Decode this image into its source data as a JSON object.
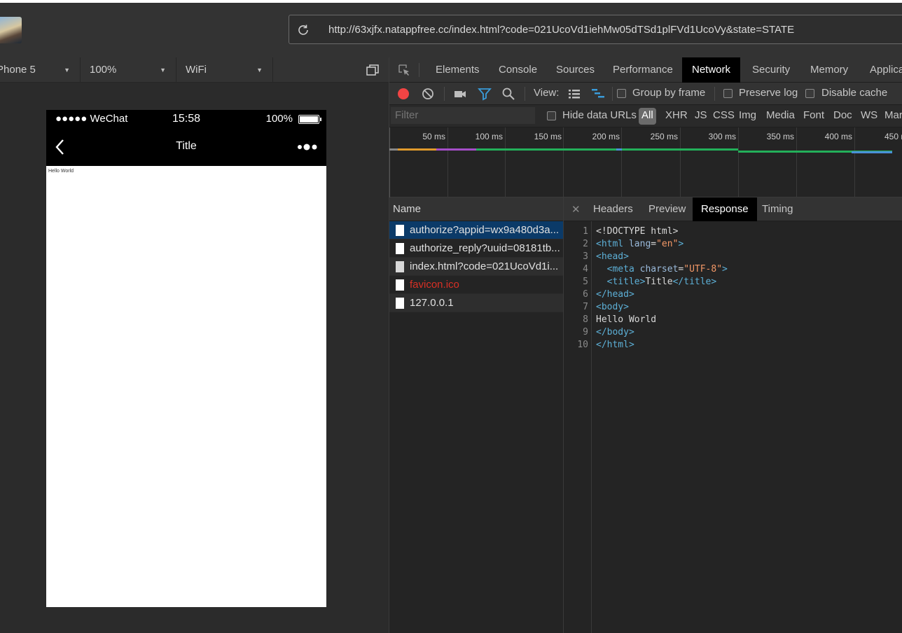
{
  "browser": {
    "url": "http://63xjfx.natappfree.cc/index.html?code=021UcoVd1iehMw05dTSd1plFVd1UcoVy&state=STATE"
  },
  "simulator": {
    "device": "Phone 5",
    "zoom": "100%",
    "network": "WiFi",
    "status_bar": {
      "carrier": "●●●●● WeChat",
      "time": "15:58",
      "battery": "100%"
    },
    "nav_title": "Title",
    "page_text": "Hello World"
  },
  "devtools": {
    "tabs": [
      "Elements",
      "Console",
      "Sources",
      "Performance",
      "Network",
      "Security",
      "Memory",
      "Applica"
    ],
    "active_tab": "Network",
    "toolbar": {
      "view_label": "View:",
      "group_by_frame": "Group by frame",
      "preserve_log": "Preserve log",
      "disable_cache": "Disable cache"
    },
    "filter": {
      "placeholder": "Filter",
      "hide_data_urls": "Hide data URLs",
      "types": [
        "All",
        "XHR",
        "JS",
        "CSS",
        "Img",
        "Media",
        "Font",
        "Doc",
        "WS",
        "Mar"
      ]
    },
    "timeline_ticks": [
      "50 ms",
      "100 ms",
      "150 ms",
      "200 ms",
      "250 ms",
      "300 ms",
      "350 ms",
      "400 ms",
      "450 m"
    ],
    "requests_header": "Name",
    "requests": [
      {
        "name": "authorize?appid=wx9a480d3a...",
        "state": "selected"
      },
      {
        "name": "authorize_reply?uuid=08181tb...",
        "state": "normal"
      },
      {
        "name": "index.html?code=021UcoVd1i...",
        "state": "zebra"
      },
      {
        "name": "favicon.ico",
        "state": "error"
      },
      {
        "name": "127.0.0.1",
        "state": "normal"
      }
    ],
    "detail_tabs": [
      "Headers",
      "Preview",
      "Response",
      "Timing"
    ],
    "active_detail_tab": "Response",
    "response_lines": [
      {
        "n": "1",
        "parts": [
          [
            "txt",
            "<!DOCTYPE html>"
          ]
        ]
      },
      {
        "n": "2",
        "parts": [
          [
            "tag",
            "<html "
          ],
          [
            "attr",
            "lang"
          ],
          [
            "txt",
            "="
          ],
          [
            "val",
            "\"en\""
          ],
          [
            "tag",
            ">"
          ]
        ]
      },
      {
        "n": "3",
        "parts": [
          [
            "tag",
            "<head>"
          ]
        ]
      },
      {
        "n": "4",
        "parts": [
          [
            "txt",
            "  "
          ],
          [
            "tag",
            "<meta "
          ],
          [
            "attr",
            "charset"
          ],
          [
            "txt",
            "="
          ],
          [
            "val",
            "\"UTF-8\""
          ],
          [
            "tag",
            ">"
          ]
        ]
      },
      {
        "n": "5",
        "parts": [
          [
            "txt",
            "  "
          ],
          [
            "tag",
            "<title>"
          ],
          [
            "txt",
            "Title"
          ],
          [
            "tag",
            "</title>"
          ]
        ]
      },
      {
        "n": "6",
        "parts": [
          [
            "tag",
            "</head>"
          ]
        ]
      },
      {
        "n": "7",
        "parts": [
          [
            "tag",
            "<body>"
          ]
        ]
      },
      {
        "n": "8",
        "parts": [
          [
            "txt",
            "Hello World"
          ]
        ]
      },
      {
        "n": "9",
        "parts": [
          [
            "tag",
            "</body>"
          ]
        ]
      },
      {
        "n": "10",
        "parts": [
          [
            "tag",
            "</html>"
          ]
        ]
      }
    ]
  },
  "colors": {
    "record": "#f24444",
    "selected_row": "#0b3a68",
    "error_text": "#d93025",
    "filter_active": "#3a9bd9"
  }
}
